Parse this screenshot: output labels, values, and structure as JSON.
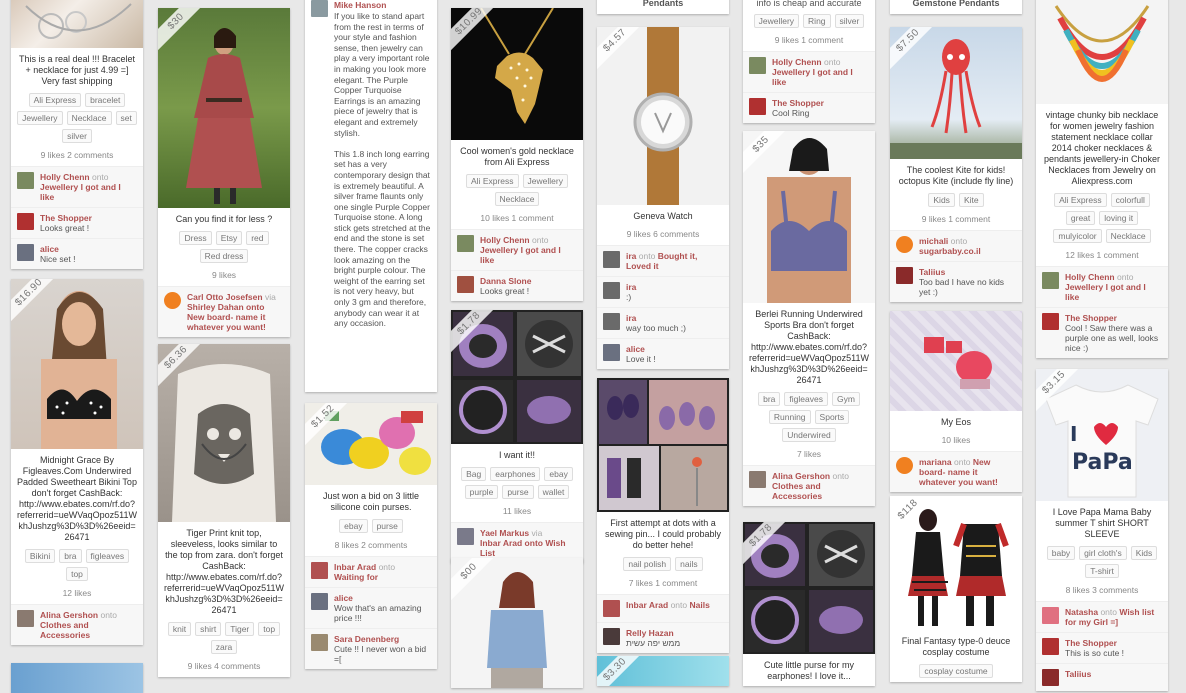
{
  "cards": {
    "c1": {
      "desc": "This is a real deal !!! Bracelet + necklace for just 4.99 =] Very fast shipping",
      "tags": [
        "Ali Express",
        "bracelet",
        "Jewellery",
        "Necklace",
        "set",
        "silver"
      ],
      "stats": "9 likes  2 comments",
      "comments": [
        {
          "name": "Holly Chenn",
          "on": "onto",
          "board": "Jewellery I got and I like"
        },
        {
          "name": "The Shopper",
          "text": "Looks great !"
        },
        {
          "name": "alice",
          "text": "Nice set !"
        }
      ]
    },
    "c2": {
      "price": "$16.90",
      "desc": "Midnight Grace By Figleaves.Com Underwired Padded Sweetheart Bikini Top don't forget CashBack: http://www.ebates.com/rf.do?referrerid=ueWVaqOpoz511WkhJushzg%3D%3D%26eeid=26471",
      "tags": [
        "Bikini",
        "bra",
        "figleaves",
        "top"
      ],
      "stats": "12 likes",
      "comments": [
        {
          "name": "Alina Gershon",
          "on": "onto",
          "board": "Clothes and Accessories"
        }
      ]
    },
    "c3": {
      "price": "$30",
      "desc": "Can you find it for less ?",
      "tags": [
        "Dress",
        "Etsy",
        "red",
        "Red dress"
      ],
      "stats": "9 likes",
      "comments": [
        {
          "name": "Carl Otto Josefsen",
          "on": "via",
          "board": "Shirley Dahan onto New board- name it whatever you want!"
        }
      ]
    },
    "c4": {
      "price": "$6.36",
      "desc": "Tiger Print knit top, sleeveless, looks similar to the top from zara. don't forget CashBack: http://www.ebates.com/rf.do?referrerid=ueWVaqOpoz511WkhJushzg%3D%3D%26eeid=26471",
      "tags": [
        "knit",
        "shirt",
        "Tiger",
        "top",
        "zara"
      ],
      "stats": "9 likes  4 comments"
    },
    "c5": {
      "head": "Mike Hanson",
      "desc": "If you like to stand apart from the rest in terms of your style and fashion sense, then jewelry can play a very important role in making you look more elegant. The Purple Copper Turquoise Earrings is an amazing piece of jewelry that is elegant and extremely stylish.\n\nThis 1.8 inch long earring set has a very contemporary design that is extremely beautiful. A silver frame flaunts only one single Purple Copper Turquoise stone. A long stick gets stretched at the end and the stone is set there. The copper cracks look amazing on the bright purple colour. The weight of the earring set is not very heavy, but only 3 gm and therefore, anybody can wear it at any occasion."
    },
    "c6": {
      "price": "$1.52",
      "desc": "Just won a bid on 3 little silicone coin purses.",
      "tags": [
        "ebay",
        "purse"
      ],
      "stats": "8 likes  2 comments",
      "comments": [
        {
          "name": "Inbar Arad",
          "on": "onto",
          "board": "Waiting for"
        },
        {
          "name": "alice",
          "text": "Wow that's an amazing price !!!"
        },
        {
          "name": "Sara Denenberg",
          "text": "Cute !! I never won a bid =["
        }
      ]
    },
    "c7": {
      "price": "$10.99",
      "desc": "Cool women's gold necklace from Ali Express",
      "tags": [
        "Ali Express",
        "Jewellery",
        "Necklace"
      ],
      "stats": "10 likes  1 comment",
      "comments": [
        {
          "name": "Holly Chenn",
          "on": "onto",
          "board": "Jewellery I got and I like"
        },
        {
          "name": "Danna Slone",
          "text": "Looks great !"
        }
      ]
    },
    "c8": {
      "price": "$1.78",
      "desc": "I want it!!",
      "tags": [
        "Bag",
        "earphones",
        "ebay",
        "purple",
        "purse",
        "wallet"
      ],
      "stats": "11 likes",
      "comments": [
        {
          "name": "Yael Markus",
          "on": "via",
          "board": "Inbar Arad onto Wish List"
        }
      ]
    },
    "c9": {
      "price": "$00"
    },
    "c10": {
      "top": "Pendants"
    },
    "c11": {
      "price": "$4.57",
      "desc": "Geneva Watch",
      "stats": "9 likes  6 comments",
      "comments": [
        {
          "name": "ira",
          "on": "onto",
          "board": "Bought it, Loved it"
        },
        {
          "name": "ira",
          "text": ":)"
        },
        {
          "name": "ira",
          "text": "way too much ;)"
        },
        {
          "name": "alice",
          "text": "Love it !"
        }
      ]
    },
    "c12": {
      "desc": "First attempt at dots with a sewing pin... I could probably do better hehe!",
      "tags": [
        "nail polish",
        "nails"
      ],
      "stats": "7 likes  1 comment",
      "comments": [
        {
          "name": "Inbar Arad",
          "on": "onto",
          "board": "Nails"
        },
        {
          "name": "Relly Hazan",
          "text": "ממש יפה עשית"
        }
      ]
    },
    "c13": {
      "price": "$3.30"
    },
    "c14": {
      "top": "info is cheap and accurate",
      "tags": [
        "Jewellery",
        "Ring",
        "silver"
      ],
      "stats": "9 likes  1 comment",
      "comments": [
        {
          "name": "Holly Chenn",
          "on": "onto",
          "board": "Jewellery I got and I like"
        },
        {
          "name": "The Shopper",
          "text": "Cool Ring"
        }
      ]
    },
    "c15": {
      "price": "$35",
      "desc": "Berlei Running Underwired Sports Bra don't forget CashBack: http://www.ebates.com/rf.do?referrerid=ueWVaqOpoz511WkhJushzg%3D%3D%26eeid=26471",
      "tags": [
        "bra",
        "figleaves",
        "Gym",
        "Running",
        "Sports",
        "Underwired"
      ],
      "stats": "7 likes",
      "comments": [
        {
          "name": "Alina Gershon",
          "on": "onto",
          "board": "Clothes and Accessories"
        }
      ]
    },
    "c16": {
      "price": "$1.78",
      "desc": "Cute little purse for my earphones! I love it..."
    },
    "c17": {
      "top": "Gemstone Pendants"
    },
    "c18": {
      "price": "$7.50",
      "desc": "The coolest Kite for kids! octopus Kite (include fly line)",
      "tags": [
        "Kids",
        "Kite"
      ],
      "stats": "9 likes  1 comment",
      "comments": [
        {
          "name": "michali",
          "on": "onto",
          "board": "sugarbaby.co.il"
        },
        {
          "name": "Taliius",
          "text": "Too bad I have no kids yet :)"
        }
      ]
    },
    "c19": {
      "desc": "My Eos",
      "stats": "10 likes",
      "comments": [
        {
          "name": "mariana",
          "on": "onto",
          "board": "New board- name it whatever you want!"
        }
      ]
    },
    "c20": {
      "price": "$118",
      "desc": "Final Fantasy type-0 deuce cosplay costume",
      "tags": [
        "cosplay costume"
      ]
    },
    "c21": {
      "desc": "vintage chunky bib necklace for women jewelry fashion statement necklace collar 2014 choker necklaces & pendants jewellery-in Choker Necklaces from Jewelry on Aliexpress.com",
      "tags": [
        "Ali Express",
        "colorfull",
        "great",
        "loving it",
        "mulyicolor",
        "Necklace"
      ],
      "stats": "12 likes  1 comment",
      "comments": [
        {
          "name": "Holly Chenn",
          "on": "onto",
          "board": "Jewellery I got and I like"
        },
        {
          "name": "The Shopper",
          "text": "Cool ! Saw there was a purple one as well, looks nice :)"
        }
      ]
    },
    "c22": {
      "price": "$3.15",
      "desc": "I Love Papa Mama Baby summer T shirt SHORT SLEEVE",
      "tags": [
        "baby",
        "girl cloth's",
        "Kids",
        "T-shirt"
      ],
      "stats": "8 likes  3 comments",
      "comments": [
        {
          "name": "Natasha",
          "on": "onto",
          "board": "Wish list for my Girl =]"
        },
        {
          "name": "The Shopper",
          "text": "This is so cute !"
        },
        {
          "name": "Taliius",
          "text": ""
        }
      ]
    }
  },
  "colors": {
    "pin_link": "#b05050",
    "background": "#e8e8e8"
  }
}
